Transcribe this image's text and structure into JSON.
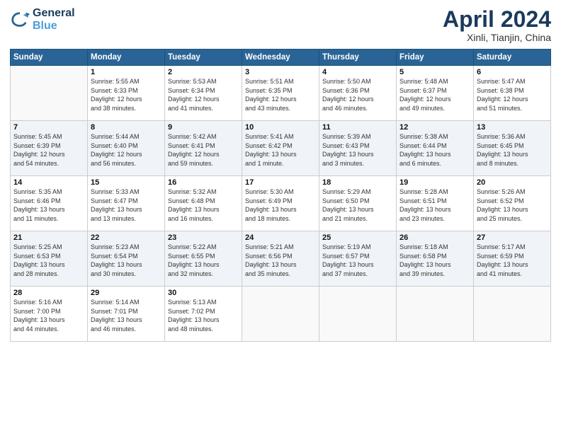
{
  "header": {
    "logo_line1": "General",
    "logo_line2": "Blue",
    "month_title": "April 2024",
    "location": "Xinli, Tianjin, China"
  },
  "weekdays": [
    "Sunday",
    "Monday",
    "Tuesday",
    "Wednesday",
    "Thursday",
    "Friday",
    "Saturday"
  ],
  "weeks": [
    [
      {
        "num": "",
        "info": ""
      },
      {
        "num": "1",
        "info": "Sunrise: 5:55 AM\nSunset: 6:33 PM\nDaylight: 12 hours\nand 38 minutes."
      },
      {
        "num": "2",
        "info": "Sunrise: 5:53 AM\nSunset: 6:34 PM\nDaylight: 12 hours\nand 41 minutes."
      },
      {
        "num": "3",
        "info": "Sunrise: 5:51 AM\nSunset: 6:35 PM\nDaylight: 12 hours\nand 43 minutes."
      },
      {
        "num": "4",
        "info": "Sunrise: 5:50 AM\nSunset: 6:36 PM\nDaylight: 12 hours\nand 46 minutes."
      },
      {
        "num": "5",
        "info": "Sunrise: 5:48 AM\nSunset: 6:37 PM\nDaylight: 12 hours\nand 49 minutes."
      },
      {
        "num": "6",
        "info": "Sunrise: 5:47 AM\nSunset: 6:38 PM\nDaylight: 12 hours\nand 51 minutes."
      }
    ],
    [
      {
        "num": "7",
        "info": "Sunrise: 5:45 AM\nSunset: 6:39 PM\nDaylight: 12 hours\nand 54 minutes."
      },
      {
        "num": "8",
        "info": "Sunrise: 5:44 AM\nSunset: 6:40 PM\nDaylight: 12 hours\nand 56 minutes."
      },
      {
        "num": "9",
        "info": "Sunrise: 5:42 AM\nSunset: 6:41 PM\nDaylight: 12 hours\nand 59 minutes."
      },
      {
        "num": "10",
        "info": "Sunrise: 5:41 AM\nSunset: 6:42 PM\nDaylight: 13 hours\nand 1 minute."
      },
      {
        "num": "11",
        "info": "Sunrise: 5:39 AM\nSunset: 6:43 PM\nDaylight: 13 hours\nand 3 minutes."
      },
      {
        "num": "12",
        "info": "Sunrise: 5:38 AM\nSunset: 6:44 PM\nDaylight: 13 hours\nand 6 minutes."
      },
      {
        "num": "13",
        "info": "Sunrise: 5:36 AM\nSunset: 6:45 PM\nDaylight: 13 hours\nand 8 minutes."
      }
    ],
    [
      {
        "num": "14",
        "info": "Sunrise: 5:35 AM\nSunset: 6:46 PM\nDaylight: 13 hours\nand 11 minutes."
      },
      {
        "num": "15",
        "info": "Sunrise: 5:33 AM\nSunset: 6:47 PM\nDaylight: 13 hours\nand 13 minutes."
      },
      {
        "num": "16",
        "info": "Sunrise: 5:32 AM\nSunset: 6:48 PM\nDaylight: 13 hours\nand 16 minutes."
      },
      {
        "num": "17",
        "info": "Sunrise: 5:30 AM\nSunset: 6:49 PM\nDaylight: 13 hours\nand 18 minutes."
      },
      {
        "num": "18",
        "info": "Sunrise: 5:29 AM\nSunset: 6:50 PM\nDaylight: 13 hours\nand 21 minutes."
      },
      {
        "num": "19",
        "info": "Sunrise: 5:28 AM\nSunset: 6:51 PM\nDaylight: 13 hours\nand 23 minutes."
      },
      {
        "num": "20",
        "info": "Sunrise: 5:26 AM\nSunset: 6:52 PM\nDaylight: 13 hours\nand 25 minutes."
      }
    ],
    [
      {
        "num": "21",
        "info": "Sunrise: 5:25 AM\nSunset: 6:53 PM\nDaylight: 13 hours\nand 28 minutes."
      },
      {
        "num": "22",
        "info": "Sunrise: 5:23 AM\nSunset: 6:54 PM\nDaylight: 13 hours\nand 30 minutes."
      },
      {
        "num": "23",
        "info": "Sunrise: 5:22 AM\nSunset: 6:55 PM\nDaylight: 13 hours\nand 32 minutes."
      },
      {
        "num": "24",
        "info": "Sunrise: 5:21 AM\nSunset: 6:56 PM\nDaylight: 13 hours\nand 35 minutes."
      },
      {
        "num": "25",
        "info": "Sunrise: 5:19 AM\nSunset: 6:57 PM\nDaylight: 13 hours\nand 37 minutes."
      },
      {
        "num": "26",
        "info": "Sunrise: 5:18 AM\nSunset: 6:58 PM\nDaylight: 13 hours\nand 39 minutes."
      },
      {
        "num": "27",
        "info": "Sunrise: 5:17 AM\nSunset: 6:59 PM\nDaylight: 13 hours\nand 41 minutes."
      }
    ],
    [
      {
        "num": "28",
        "info": "Sunrise: 5:16 AM\nSunset: 7:00 PM\nDaylight: 13 hours\nand 44 minutes."
      },
      {
        "num": "29",
        "info": "Sunrise: 5:14 AM\nSunset: 7:01 PM\nDaylight: 13 hours\nand 46 minutes."
      },
      {
        "num": "30",
        "info": "Sunrise: 5:13 AM\nSunset: 7:02 PM\nDaylight: 13 hours\nand 48 minutes."
      },
      {
        "num": "",
        "info": ""
      },
      {
        "num": "",
        "info": ""
      },
      {
        "num": "",
        "info": ""
      },
      {
        "num": "",
        "info": ""
      }
    ]
  ]
}
